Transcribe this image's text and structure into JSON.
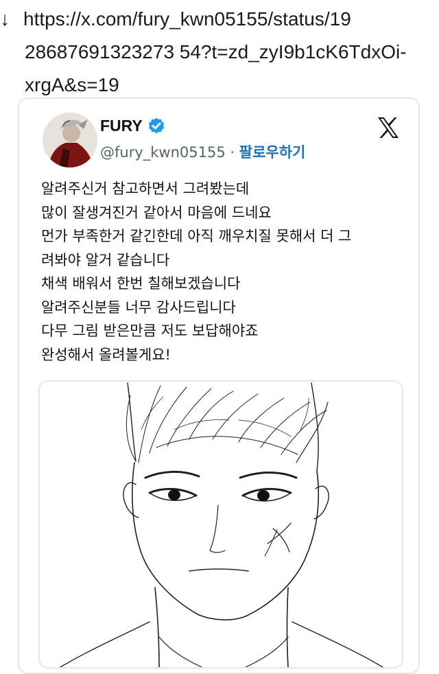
{
  "link": {
    "arrow_glyph": "↓",
    "url": "https://x.com/fury_kwn05155/status/1928687691323273 54?t=zd_zyI9b1cK6TdxOi-xrgA&s=19",
    "url_lines": [
      "https://x.com/fury_kwn05155/status/19",
      "28687691323273 54?t=zd_zyI9b1cK6TdxOi-",
      "xrgA&s=19"
    ]
  },
  "tweet": {
    "author_name": "FURY",
    "verified_icon": "verified-badge-icon",
    "handle": "@fury_kwn05155",
    "separator": "·",
    "follow_label": "팔로우하기",
    "platform_icon": "x-logo-icon",
    "text_lines": [
      "알려주신거 참고하면서 그려봤는데",
      "많이 잘생겨진거 같아서 마음에 드네요",
      "먼가 부족한거 같긴한데 아직 깨우치질 못해서 더 그",
      "려봐야 알거 같습니다",
      "채색 배워서 한번 칠해보겠습니다",
      "알려주신분들 너무 감사드립니다",
      "다무 그림 받은만큼 저도 보답해야죠",
      "완성해서 올려볼게요!"
    ],
    "media_description_icon": "sketch-image"
  },
  "colors": {
    "text": "#0f1419",
    "secondary": "#536471",
    "link": "#1d6fb8",
    "verified": "#1d9bf0",
    "border": "#e3e6ea"
  }
}
